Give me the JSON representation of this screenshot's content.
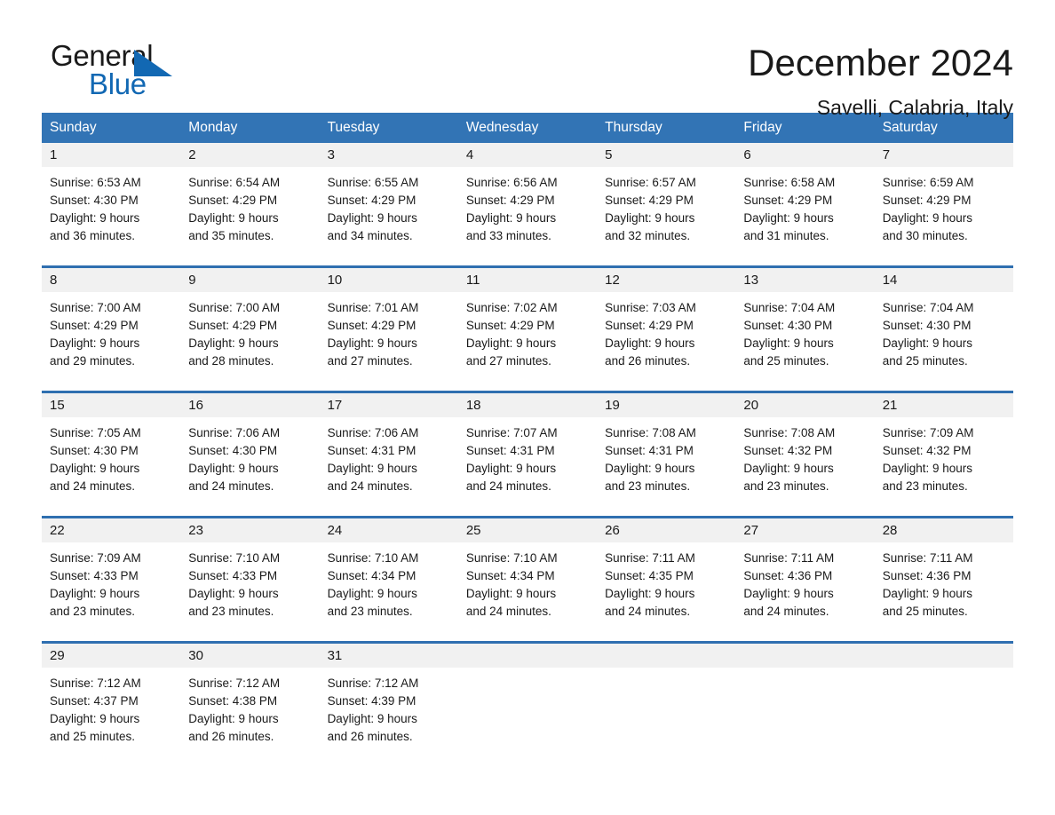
{
  "logo": {
    "word_one": "General",
    "word_two": "Blue",
    "triangle": "blue-triangle-icon",
    "accent_color": "#1268b3"
  },
  "header": {
    "title": "December 2024",
    "location": "Savelli, Calabria, Italy"
  },
  "theme": {
    "header_bg": "#3274b5",
    "row_border": "#2f6fb0",
    "date_band_bg": "#f1f1f1"
  },
  "day_names": [
    "Sunday",
    "Monday",
    "Tuesday",
    "Wednesday",
    "Thursday",
    "Friday",
    "Saturday"
  ],
  "weeks": [
    [
      {
        "day": "1",
        "sunrise": "Sunrise: 6:53 AM",
        "sunset": "Sunset: 4:30 PM",
        "daylight_1": "Daylight: 9 hours",
        "daylight_2": "and 36 minutes."
      },
      {
        "day": "2",
        "sunrise": "Sunrise: 6:54 AM",
        "sunset": "Sunset: 4:29 PM",
        "daylight_1": "Daylight: 9 hours",
        "daylight_2": "and 35 minutes."
      },
      {
        "day": "3",
        "sunrise": "Sunrise: 6:55 AM",
        "sunset": "Sunset: 4:29 PM",
        "daylight_1": "Daylight: 9 hours",
        "daylight_2": "and 34 minutes."
      },
      {
        "day": "4",
        "sunrise": "Sunrise: 6:56 AM",
        "sunset": "Sunset: 4:29 PM",
        "daylight_1": "Daylight: 9 hours",
        "daylight_2": "and 33 minutes."
      },
      {
        "day": "5",
        "sunrise": "Sunrise: 6:57 AM",
        "sunset": "Sunset: 4:29 PM",
        "daylight_1": "Daylight: 9 hours",
        "daylight_2": "and 32 minutes."
      },
      {
        "day": "6",
        "sunrise": "Sunrise: 6:58 AM",
        "sunset": "Sunset: 4:29 PM",
        "daylight_1": "Daylight: 9 hours",
        "daylight_2": "and 31 minutes."
      },
      {
        "day": "7",
        "sunrise": "Sunrise: 6:59 AM",
        "sunset": "Sunset: 4:29 PM",
        "daylight_1": "Daylight: 9 hours",
        "daylight_2": "and 30 minutes."
      }
    ],
    [
      {
        "day": "8",
        "sunrise": "Sunrise: 7:00 AM",
        "sunset": "Sunset: 4:29 PM",
        "daylight_1": "Daylight: 9 hours",
        "daylight_2": "and 29 minutes."
      },
      {
        "day": "9",
        "sunrise": "Sunrise: 7:00 AM",
        "sunset": "Sunset: 4:29 PM",
        "daylight_1": "Daylight: 9 hours",
        "daylight_2": "and 28 minutes."
      },
      {
        "day": "10",
        "sunrise": "Sunrise: 7:01 AM",
        "sunset": "Sunset: 4:29 PM",
        "daylight_1": "Daylight: 9 hours",
        "daylight_2": "and 27 minutes."
      },
      {
        "day": "11",
        "sunrise": "Sunrise: 7:02 AM",
        "sunset": "Sunset: 4:29 PM",
        "daylight_1": "Daylight: 9 hours",
        "daylight_2": "and 27 minutes."
      },
      {
        "day": "12",
        "sunrise": "Sunrise: 7:03 AM",
        "sunset": "Sunset: 4:29 PM",
        "daylight_1": "Daylight: 9 hours",
        "daylight_2": "and 26 minutes."
      },
      {
        "day": "13",
        "sunrise": "Sunrise: 7:04 AM",
        "sunset": "Sunset: 4:30 PM",
        "daylight_1": "Daylight: 9 hours",
        "daylight_2": "and 25 minutes."
      },
      {
        "day": "14",
        "sunrise": "Sunrise: 7:04 AM",
        "sunset": "Sunset: 4:30 PM",
        "daylight_1": "Daylight: 9 hours",
        "daylight_2": "and 25 minutes."
      }
    ],
    [
      {
        "day": "15",
        "sunrise": "Sunrise: 7:05 AM",
        "sunset": "Sunset: 4:30 PM",
        "daylight_1": "Daylight: 9 hours",
        "daylight_2": "and 24 minutes."
      },
      {
        "day": "16",
        "sunrise": "Sunrise: 7:06 AM",
        "sunset": "Sunset: 4:30 PM",
        "daylight_1": "Daylight: 9 hours",
        "daylight_2": "and 24 minutes."
      },
      {
        "day": "17",
        "sunrise": "Sunrise: 7:06 AM",
        "sunset": "Sunset: 4:31 PM",
        "daylight_1": "Daylight: 9 hours",
        "daylight_2": "and 24 minutes."
      },
      {
        "day": "18",
        "sunrise": "Sunrise: 7:07 AM",
        "sunset": "Sunset: 4:31 PM",
        "daylight_1": "Daylight: 9 hours",
        "daylight_2": "and 24 minutes."
      },
      {
        "day": "19",
        "sunrise": "Sunrise: 7:08 AM",
        "sunset": "Sunset: 4:31 PM",
        "daylight_1": "Daylight: 9 hours",
        "daylight_2": "and 23 minutes."
      },
      {
        "day": "20",
        "sunrise": "Sunrise: 7:08 AM",
        "sunset": "Sunset: 4:32 PM",
        "daylight_1": "Daylight: 9 hours",
        "daylight_2": "and 23 minutes."
      },
      {
        "day": "21",
        "sunrise": "Sunrise: 7:09 AM",
        "sunset": "Sunset: 4:32 PM",
        "daylight_1": "Daylight: 9 hours",
        "daylight_2": "and 23 minutes."
      }
    ],
    [
      {
        "day": "22",
        "sunrise": "Sunrise: 7:09 AM",
        "sunset": "Sunset: 4:33 PM",
        "daylight_1": "Daylight: 9 hours",
        "daylight_2": "and 23 minutes."
      },
      {
        "day": "23",
        "sunrise": "Sunrise: 7:10 AM",
        "sunset": "Sunset: 4:33 PM",
        "daylight_1": "Daylight: 9 hours",
        "daylight_2": "and 23 minutes."
      },
      {
        "day": "24",
        "sunrise": "Sunrise: 7:10 AM",
        "sunset": "Sunset: 4:34 PM",
        "daylight_1": "Daylight: 9 hours",
        "daylight_2": "and 23 minutes."
      },
      {
        "day": "25",
        "sunrise": "Sunrise: 7:10 AM",
        "sunset": "Sunset: 4:34 PM",
        "daylight_1": "Daylight: 9 hours",
        "daylight_2": "and 24 minutes."
      },
      {
        "day": "26",
        "sunrise": "Sunrise: 7:11 AM",
        "sunset": "Sunset: 4:35 PM",
        "daylight_1": "Daylight: 9 hours",
        "daylight_2": "and 24 minutes."
      },
      {
        "day": "27",
        "sunrise": "Sunrise: 7:11 AM",
        "sunset": "Sunset: 4:36 PM",
        "daylight_1": "Daylight: 9 hours",
        "daylight_2": "and 24 minutes."
      },
      {
        "day": "28",
        "sunrise": "Sunrise: 7:11 AM",
        "sunset": "Sunset: 4:36 PM",
        "daylight_1": "Daylight: 9 hours",
        "daylight_2": "and 25 minutes."
      }
    ],
    [
      {
        "day": "29",
        "sunrise": "Sunrise: 7:12 AM",
        "sunset": "Sunset: 4:37 PM",
        "daylight_1": "Daylight: 9 hours",
        "daylight_2": "and 25 minutes."
      },
      {
        "day": "30",
        "sunrise": "Sunrise: 7:12 AM",
        "sunset": "Sunset: 4:38 PM",
        "daylight_1": "Daylight: 9 hours",
        "daylight_2": "and 26 minutes."
      },
      {
        "day": "31",
        "sunrise": "Sunrise: 7:12 AM",
        "sunset": "Sunset: 4:39 PM",
        "daylight_1": "Daylight: 9 hours",
        "daylight_2": "and 26 minutes."
      },
      {
        "day": "",
        "sunrise": "",
        "sunset": "",
        "daylight_1": "",
        "daylight_2": ""
      },
      {
        "day": "",
        "sunrise": "",
        "sunset": "",
        "daylight_1": "",
        "daylight_2": ""
      },
      {
        "day": "",
        "sunrise": "",
        "sunset": "",
        "daylight_1": "",
        "daylight_2": ""
      },
      {
        "day": "",
        "sunrise": "",
        "sunset": "",
        "daylight_1": "",
        "daylight_2": ""
      }
    ]
  ]
}
